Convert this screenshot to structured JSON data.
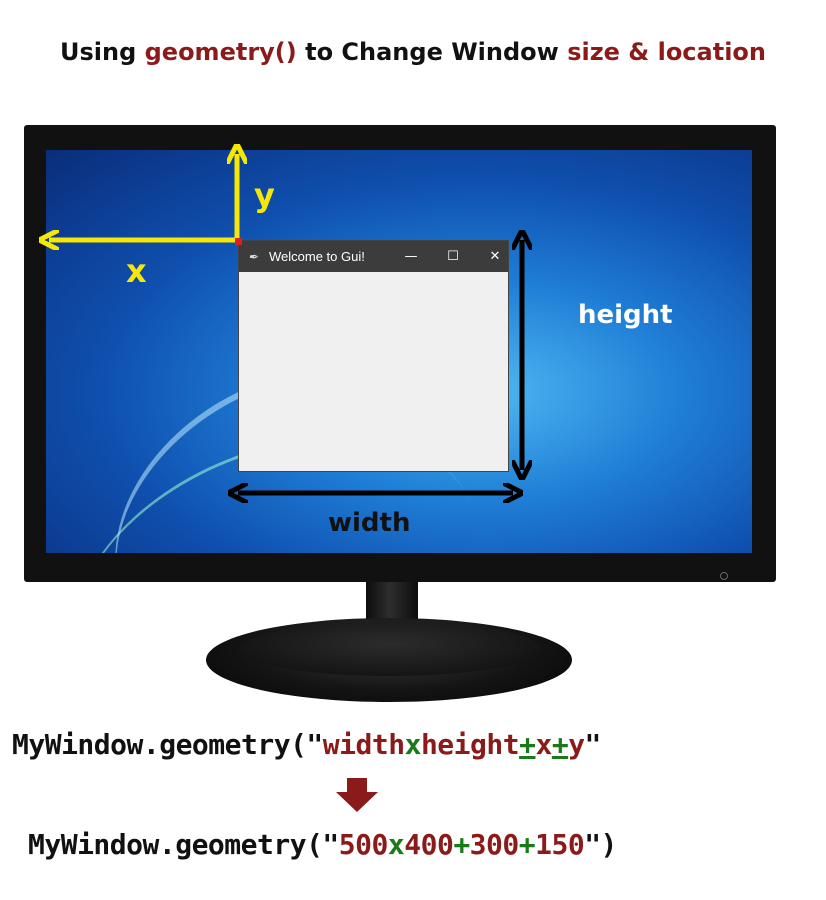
{
  "title": {
    "part1": "Using ",
    "part2": "geometry()",
    "part3": " to Change Window ",
    "part4": "size & location"
  },
  "window": {
    "title": "Welcome to Gui!",
    "icon": "feather-icon",
    "controls": {
      "minimize": "—",
      "maximize": "☐",
      "close": "✕"
    }
  },
  "labels": {
    "x": "x",
    "y": "y",
    "height": "height",
    "width": "width"
  },
  "code_template": {
    "prefix": "MyWindow.geometry(\"",
    "w": "width",
    "sep1": "x",
    "h": "height",
    "sep2": "+",
    "x": "x",
    "sep3": "+",
    "y": "y",
    "suffix": "\""
  },
  "code_example": {
    "prefix": "MyWindow.geometry(\"",
    "w": "500",
    "sep1": "x",
    "h": "400",
    "sep2": "+",
    "x": "300",
    "sep3": "+",
    "y": "150",
    "suffix": "\")"
  },
  "colors": {
    "accent_red": "#8b1a1a",
    "accent_green": "#1a7a1a",
    "arrow_yellow": "#f6e705",
    "arrow_black": "#000000"
  }
}
